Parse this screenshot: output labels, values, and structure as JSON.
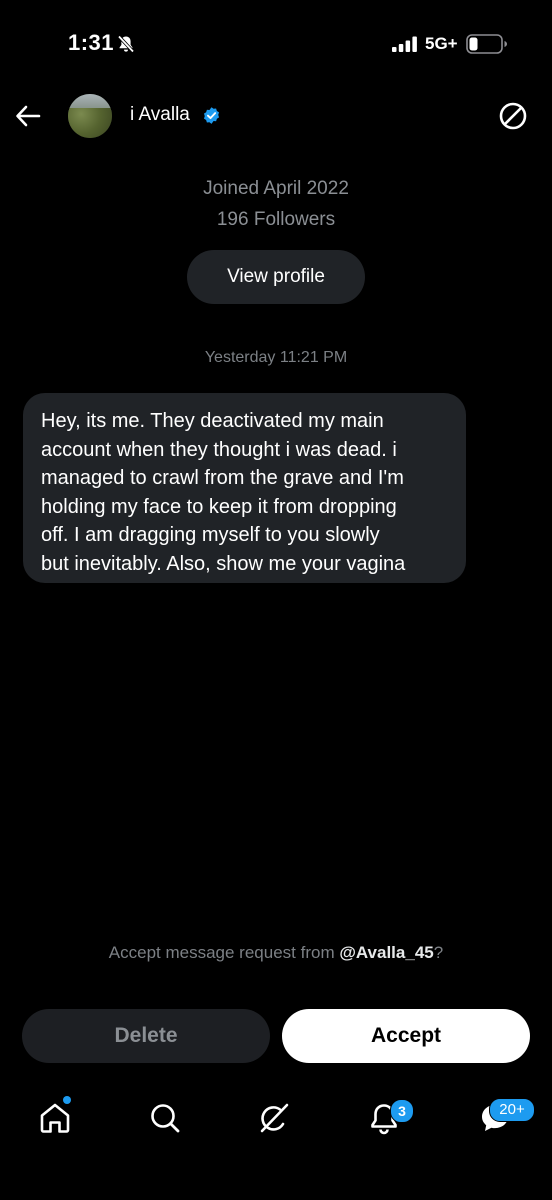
{
  "status_bar": {
    "time": "1:31",
    "network": "5G+",
    "icons": [
      "bell-muted-icon",
      "signal-icon",
      "battery-icon"
    ]
  },
  "header": {
    "display_name": "i Avalla",
    "verified": true,
    "icons": [
      "back-arrow-icon",
      "verified-badge-icon",
      "block-icon"
    ],
    "accent_color": "#1d9bf0"
  },
  "profile": {
    "joined": "Joined April 2022",
    "followers": "196 Followers",
    "view_profile_label": "View profile"
  },
  "conversation": {
    "timestamp": "Yesterday 11:21 PM",
    "message": {
      "lines": [
        "Hey, its me.  They deactivated my main",
        "account when they thought i was dead.  i",
        "managed to crawl from the grave and I'm",
        "holding my face to keep it from dropping",
        "off.  I am dragging myself to you slowly",
        "but inevitably.  Also, show me your vagina"
      ]
    }
  },
  "request": {
    "prompt_prefix": "Accept message request from ",
    "handle": "@Avalla_45",
    "prompt_suffix": "?",
    "delete_label": "Delete",
    "accept_label": "Accept"
  },
  "bottom_nav": {
    "items": [
      "home-icon",
      "search-icon",
      "grok-icon",
      "notifications-icon",
      "messages-icon"
    ],
    "notifications_badge": "3",
    "messages_badge": "20+"
  }
}
